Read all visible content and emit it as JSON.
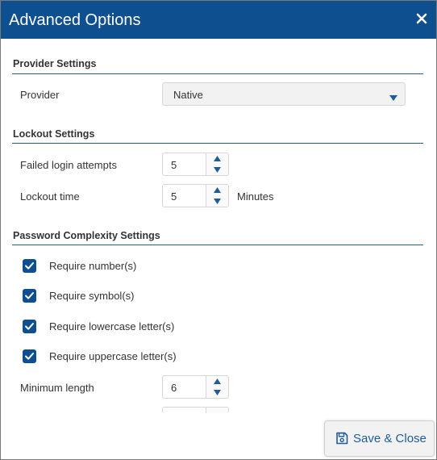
{
  "dialog": {
    "title": "Advanced Options",
    "close_icon": "close-icon"
  },
  "provider_settings": {
    "heading": "Provider Settings",
    "provider_label": "Provider",
    "provider_value": "Native"
  },
  "lockout_settings": {
    "heading": "Lockout Settings",
    "failed_attempts_label": "Failed login attempts",
    "failed_attempts_value": "5",
    "lockout_time_label": "Lockout time",
    "lockout_time_value": "5",
    "lockout_time_unit": "Minutes"
  },
  "password_complexity": {
    "heading": "Password Complexity Settings",
    "options": [
      {
        "label": "Require number(s)",
        "checked": true
      },
      {
        "label": "Require symbol(s)",
        "checked": true
      },
      {
        "label": "Require lowercase letter(s)",
        "checked": true
      },
      {
        "label": "Require uppercase letter(s)",
        "checked": true
      }
    ],
    "min_length_label": "Minimum length",
    "min_length_value": "6"
  },
  "footer": {
    "save_label": "Save & Close",
    "save_icon": "save-icon"
  },
  "colors": {
    "header_bg": "#0d4f8f",
    "accent": "#1f5d99",
    "checkbox_fill": "#0d4f8f"
  }
}
